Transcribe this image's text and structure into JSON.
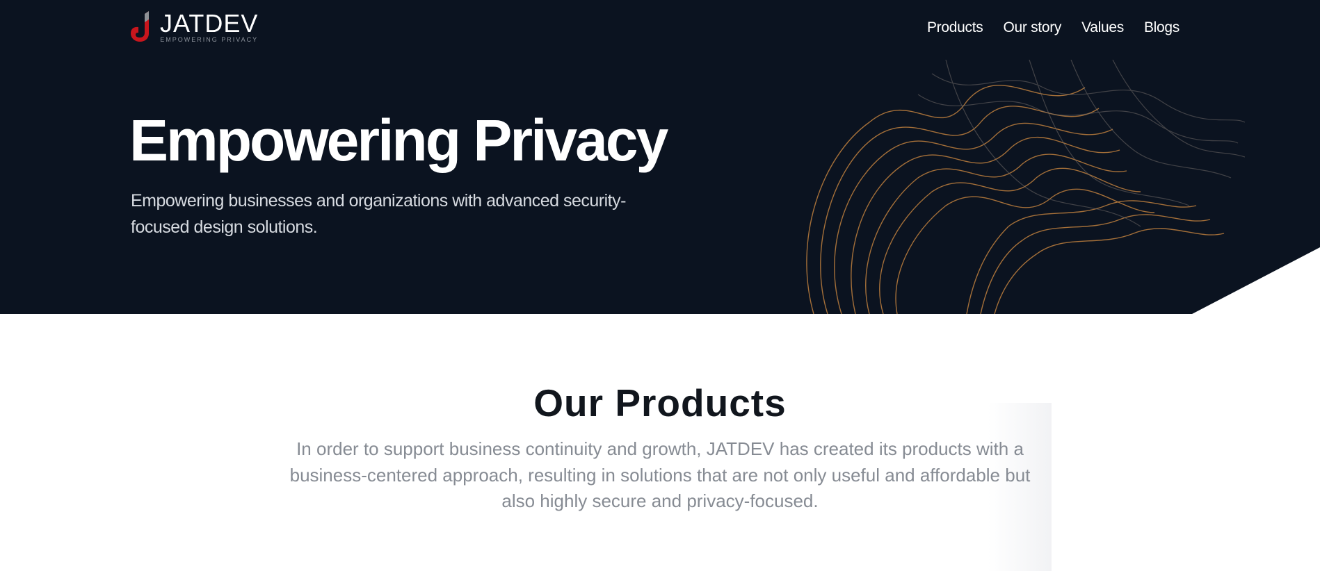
{
  "brand": {
    "name": "JATDEV",
    "tagline": "EMPOWERING PRIVACY",
    "logo_icon": "jatdev-logo-icon",
    "accent_color": "#c8161d"
  },
  "nav": {
    "items": [
      {
        "label": "Products"
      },
      {
        "label": "Our story"
      },
      {
        "label": "Values"
      },
      {
        "label": "Blogs"
      }
    ]
  },
  "hero": {
    "title": "Empowering Privacy",
    "subtitle": "Empowering businesses and organizations with advanced security-focused design solutions.",
    "background_color": "#0b1320",
    "wave_color": "#b57a3c"
  },
  "products": {
    "title": "Our Products",
    "description": "In order to support business continuity and growth, JATDEV has created its products with a business-centered approach, resulting in solutions that are not only useful and affordable but also highly secure and privacy-focused."
  }
}
